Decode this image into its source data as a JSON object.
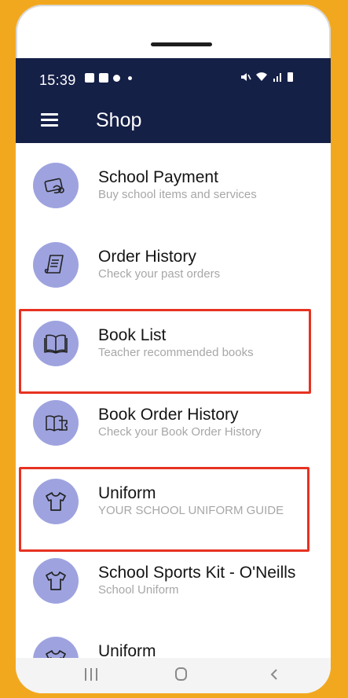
{
  "status_bar": {
    "time": "15:39"
  },
  "app_bar": {
    "title": "Shop"
  },
  "items": [
    {
      "title": "School Payment",
      "subtitle": "Buy school items and services",
      "icon": "payment-hand-icon"
    },
    {
      "title": "Order History",
      "subtitle": "Check your past orders",
      "icon": "receipt-icon"
    },
    {
      "title": "Book List",
      "subtitle": "Teacher recommended books",
      "icon": "open-book-icon"
    },
    {
      "title": "Book Order History",
      "subtitle": "Check your Book Order History",
      "icon": "book-ticket-icon"
    },
    {
      "title": "Uniform",
      "subtitle": "YOUR SCHOOL UNIFORM GUIDE",
      "icon": "tshirt-icon"
    },
    {
      "title": "School Sports Kit - O'Neills",
      "subtitle": "School Uniform",
      "icon": "tshirt-icon"
    },
    {
      "title": "Uniform",
      "subtitle": "",
      "icon": "tshirt-icon"
    }
  ],
  "colors": {
    "background": "#f2a81e",
    "app_bar": "#152047",
    "avatar": "#9ea3df",
    "highlight": "#e63222"
  }
}
